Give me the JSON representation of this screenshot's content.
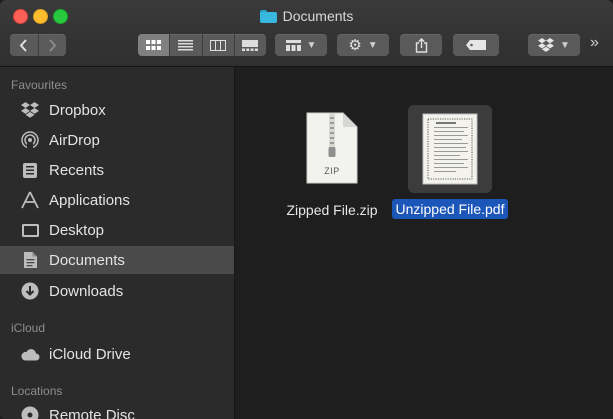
{
  "window": {
    "title": "Documents",
    "accent": "#1b56b8"
  },
  "toolbar": {
    "back_icon": "chevron-left-icon",
    "forward_icon": "chevron-right-icon",
    "view_modes": [
      "icon-view",
      "list-view",
      "column-view",
      "gallery-view"
    ],
    "selected_view": "icon-view",
    "group_icon": "group-grid-icon",
    "action_icon": "gear-icon",
    "share_icon": "share-icon",
    "tag_icon": "tag-icon",
    "dropbox_icon": "dropbox-icon",
    "overflow_label": "»"
  },
  "sidebar": {
    "sections": [
      {
        "title": "Favourites",
        "items": [
          {
            "label": "Dropbox",
            "icon": "dropbox-icon"
          },
          {
            "label": "AirDrop",
            "icon": "airdrop-icon"
          },
          {
            "label": "Recents",
            "icon": "recents-icon"
          },
          {
            "label": "Applications",
            "icon": "applications-icon"
          },
          {
            "label": "Desktop",
            "icon": "desktop-icon"
          },
          {
            "label": "Documents",
            "icon": "documents-icon",
            "selected": true
          },
          {
            "label": "Downloads",
            "icon": "downloads-icon"
          }
        ]
      },
      {
        "title": "iCloud",
        "items": [
          {
            "label": "iCloud Drive",
            "icon": "cloud-icon"
          }
        ]
      },
      {
        "title": "Locations",
        "items": [
          {
            "label": "Remote Disc",
            "icon": "disc-icon"
          }
        ]
      }
    ]
  },
  "files": [
    {
      "name": "Zipped File.zip",
      "type_label": "ZIP",
      "icon": "zip-file-icon",
      "selected": false
    },
    {
      "name": "Unzipped File.pdf",
      "icon": "pdf-file-icon",
      "selected": true
    }
  ]
}
